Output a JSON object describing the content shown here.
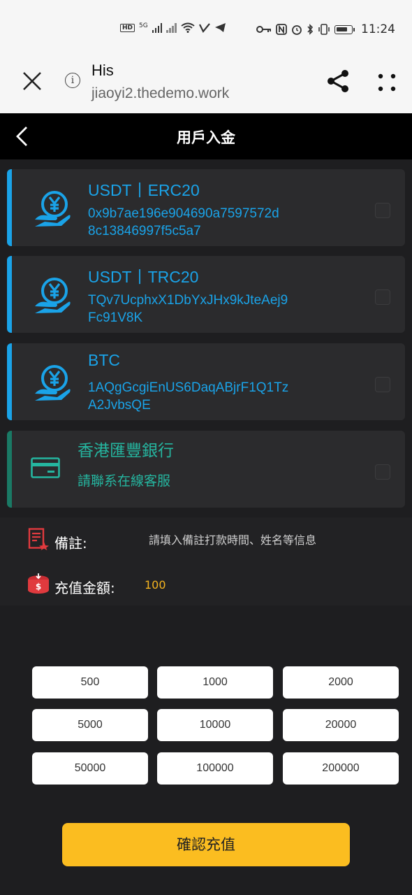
{
  "status_bar": {
    "network_badge": "HD",
    "network_type": "5G",
    "time": "11:24"
  },
  "browser": {
    "page_title": "His",
    "url": "jiaoyi2.thedemo.work"
  },
  "header": {
    "title": "用戶入金"
  },
  "payment_methods": [
    {
      "name": "USDT丨ERC20",
      "address_line1": "0x9b7ae196e904690a7597572d",
      "address_line2": "8c13846997f5c5a7",
      "icon": "yen-hand-icon",
      "color": "#1aa3e8"
    },
    {
      "name": "USDT丨TRC20",
      "address_line1": "TQv7UcphxX1DbYxJHx9kJteAej9",
      "address_line2": "Fc91V8K",
      "icon": "yen-hand-icon",
      "color": "#1aa3e8"
    },
    {
      "name": "BTC",
      "address_line1": "1AQgGcgiEnUS6DaqABjrF1Q1Tz",
      "address_line2": "A2JvbsQE",
      "icon": "yen-hand-icon",
      "color": "#1aa3e8"
    },
    {
      "name": "香港匯豐銀行",
      "address_line1": "請聯系在線客服",
      "address_line2": "",
      "icon": "bank-card-icon",
      "color": "#25b6a0"
    }
  ],
  "form": {
    "remark_label": "備註:",
    "remark_placeholder": "請填入備註打款時間、姓名等信息",
    "amount_label": "充值金額:",
    "amount_value": "100"
  },
  "amount_options": [
    "500",
    "1000",
    "2000",
    "5000",
    "10000",
    "20000",
    "50000",
    "100000",
    "200000"
  ],
  "confirm_label": "確認充值",
  "colors": {
    "accent_yellow": "#fbbd20",
    "crypto_blue": "#1aa3e8",
    "bank_green": "#25b6a0",
    "icon_red": "#e03a3e"
  }
}
